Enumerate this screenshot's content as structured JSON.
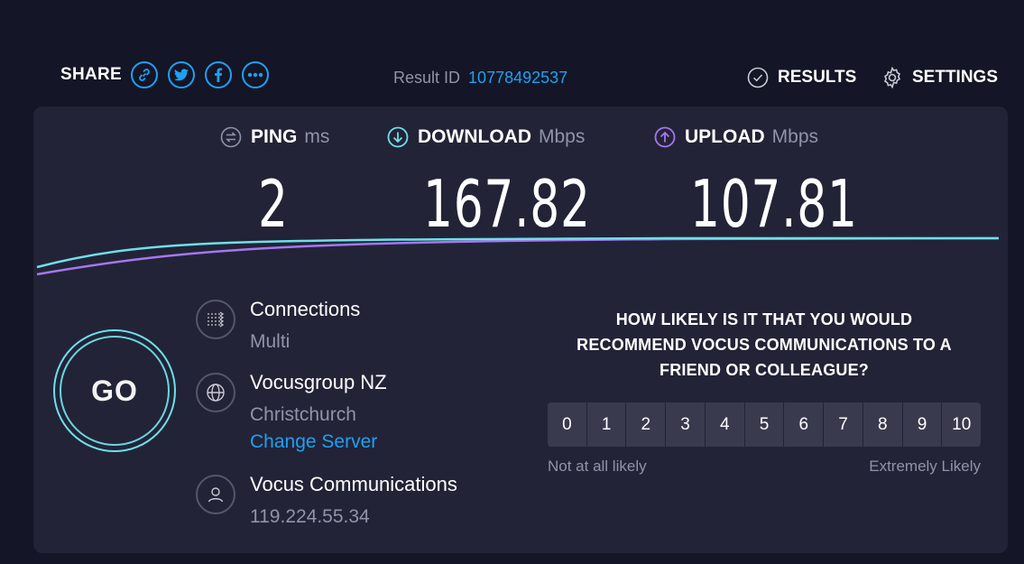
{
  "share": {
    "label": "SHARE",
    "buttons": [
      {
        "icon": "link-icon"
      },
      {
        "icon": "twitter-icon"
      },
      {
        "icon": "facebook-icon"
      },
      {
        "icon": "more-icon"
      }
    ]
  },
  "result": {
    "label": "Result ID",
    "id": "10778492537"
  },
  "nav": {
    "results_label": "RESULTS",
    "settings_label": "SETTINGS"
  },
  "metrics": {
    "ping": {
      "label": "PING",
      "unit": "ms",
      "value": "2"
    },
    "download": {
      "label": "DOWNLOAD",
      "unit": "Mbps",
      "value": "167.82"
    },
    "upload": {
      "label": "UPLOAD",
      "unit": "Mbps",
      "value": "107.81"
    }
  },
  "go": {
    "label": "GO"
  },
  "connections": {
    "title": "Connections",
    "value": "Multi"
  },
  "server": {
    "name": "Vocusgroup NZ",
    "location": "Christchurch",
    "change_label": "Change Server"
  },
  "isp": {
    "name": "Vocus Communications",
    "ip": "119.224.55.34"
  },
  "survey": {
    "question_line1": "HOW LIKELY IS IT THAT YOU WOULD",
    "question_line2": "RECOMMEND VOCUS COMMUNICATIONS TO A",
    "question_line3": "FRIEND OR COLLEAGUE?",
    "scale": [
      "0",
      "1",
      "2",
      "3",
      "4",
      "5",
      "6",
      "7",
      "8",
      "9",
      "10"
    ],
    "low_label": "Not at all likely",
    "high_label": "Extremely Likely"
  },
  "colors": {
    "background": "#141526",
    "panel": "#232337",
    "accent_blue": "#1da1f2",
    "download_line": "#6ee0e8",
    "upload_line": "#a577f0"
  }
}
